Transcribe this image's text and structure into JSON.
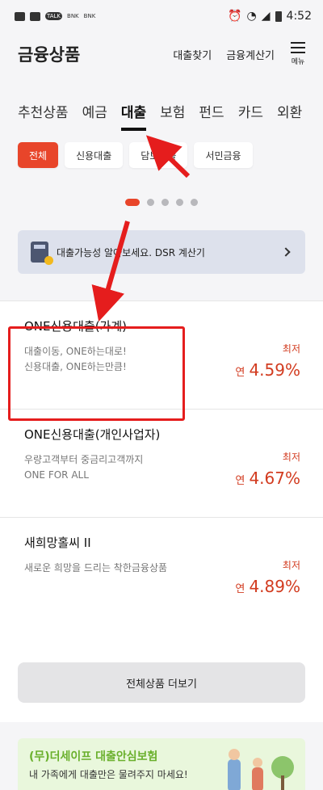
{
  "status": {
    "time": "4:52",
    "left_icons": [
      "gallery-icon",
      "image-icon",
      "talk-icon",
      "bank-icon",
      "bank-icon"
    ]
  },
  "header": {
    "title": "금융상품",
    "links": [
      "대출찾기",
      "금융계산기"
    ],
    "menu_label": "메뉴"
  },
  "tabs": [
    "추천상품",
    "예금",
    "대출",
    "보험",
    "펀드",
    "카드",
    "외환"
  ],
  "active_tab": "대출",
  "chips": [
    "전체",
    "신용대출",
    "담보대출",
    "서민금융"
  ],
  "carousel": {
    "count": 5,
    "active_index": 0
  },
  "banner": {
    "text": "대출가능성 알아보세요. DSR 계산기",
    "icon": "calculator-icon"
  },
  "products": [
    {
      "name": "ONE신용대출(가계)",
      "desc": [
        "대출이동, ONE하는대로!",
        "신용대출, ONE하는만큼!"
      ],
      "rate_label": "최저",
      "rate_prefix": "연",
      "rate": "4.59%"
    },
    {
      "name": "ONE신용대출(개인사업자)",
      "desc": [
        "우량고객부터 중금리고객까지",
        "ONE FOR ALL"
      ],
      "rate_label": "최저",
      "rate_prefix": "연",
      "rate": "4.67%"
    },
    {
      "name": "새희망홀씨 II",
      "desc": [
        "새로운 희망을 드리는 착한금융상품"
      ],
      "rate_label": "최저",
      "rate_prefix": "연",
      "rate": "4.89%"
    }
  ],
  "more_button": "전체상품 더보기",
  "promo": {
    "title": "(무)더세이프 대출안심보험",
    "subtitle": "내 가족에게 대출만은 물려주지 마세요!"
  },
  "colors": {
    "accent": "#e8452a",
    "rate": "#d23b1f",
    "annotation": "#e51d1d",
    "promo_title": "#6ab02c"
  }
}
